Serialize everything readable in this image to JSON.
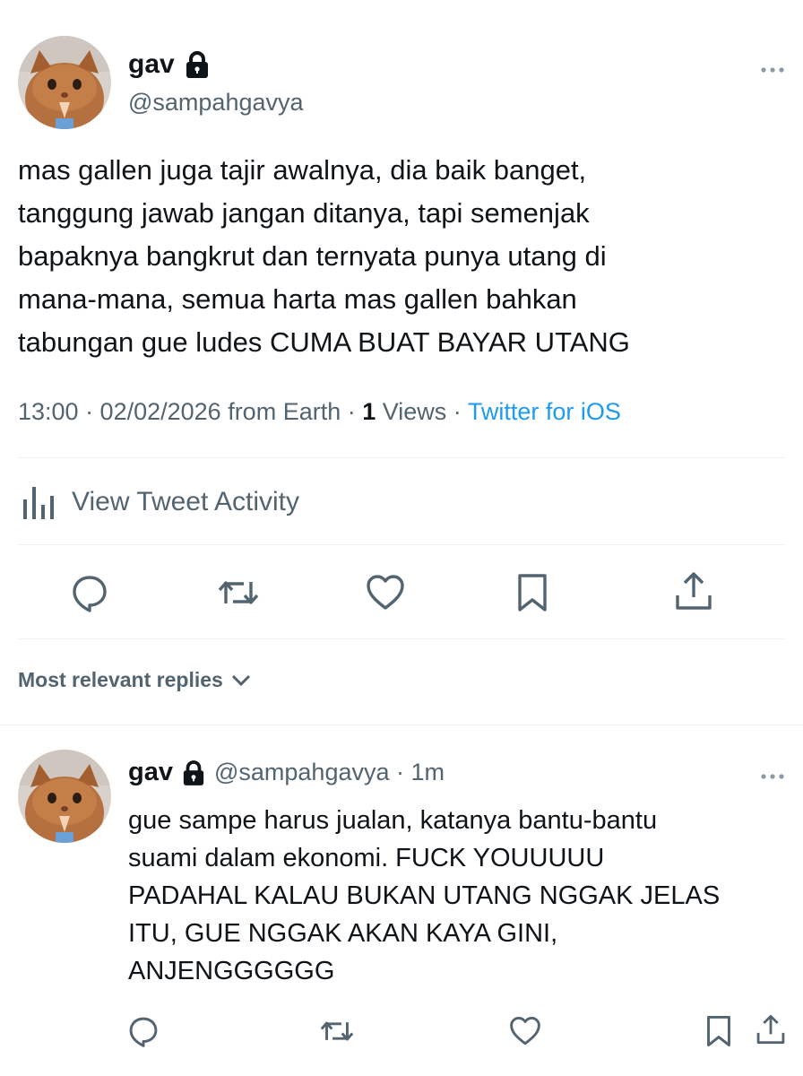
{
  "tweet": {
    "author": {
      "name": "gav",
      "handle": "@sampahgavya",
      "avatar_icon": "cat-praying-avatar",
      "lock_icon": "lock-icon"
    },
    "text": "mas gallen juga tajir awalnya, dia baik banget,\ntanggung jawab jangan ditanya, tapi semenjak\nbapaknya bangkrut dan ternyata punya utang di\nmana-mana, semua harta mas gallen bahkan\ntabungan gue ludes CUMA BUAT BAYAR UTANG",
    "meta": {
      "time_date": "13:00 · 02/02/2026 from Earth · ",
      "views_count": "1",
      "views_label": " Views · ",
      "source": "Twitter for iOS"
    },
    "activity_label": "View Tweet Activity",
    "actions": [
      "reply-icon",
      "retweet-icon",
      "like-icon",
      "bookmark-icon",
      "share-icon"
    ]
  },
  "replies_sort": {
    "label": "Most relevant replies"
  },
  "reply": {
    "name": "gav",
    "handle_time": "@sampahgavya · 1m",
    "text": "gue sampe harus jualan, katanya bantu-bantu\nsuami dalam ekonomi. FUCK YOUUUUU\nPADAHAL KALAU BUKAN UTANG NGGAK JELAS\nITU, GUE NGGAK AKAN KAYA GINI,\nANJENGGGGGG"
  },
  "colors": {
    "text": "#0f1419",
    "secondary": "#536471",
    "accent": "#1d9bf0",
    "divider": "#eff3f4"
  }
}
